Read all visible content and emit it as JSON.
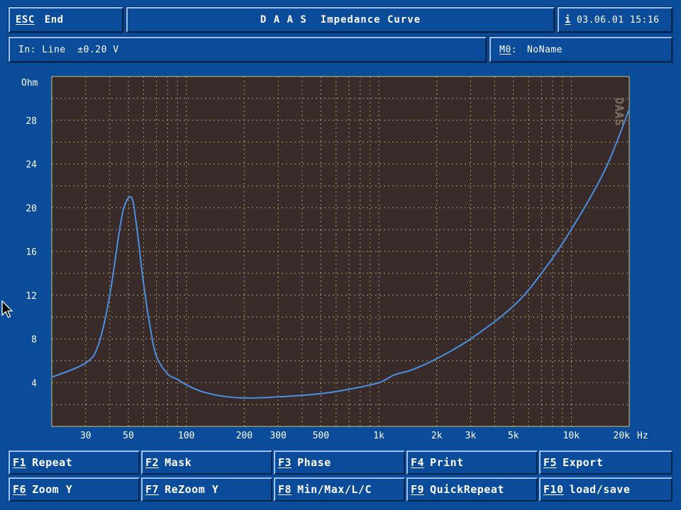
{
  "header": {
    "esc_key": "ESC",
    "esc_label": "End",
    "title": "D A A S  Impedance Curve",
    "info_key": "i",
    "datetime": "03.06.01 15:16"
  },
  "status": {
    "input": "In: Line  ±0.20 V",
    "mem_key": "M0",
    "mem_sep": ":",
    "mem_name": "NoName"
  },
  "plot": {
    "y_unit": "Ohm",
    "x_unit": "Hz",
    "watermark": "DAAS",
    "colors": {
      "background": "#3a2b2b",
      "grid": "#c8c47a",
      "curve": "#4a8fe0"
    }
  },
  "chart_data": {
    "type": "line",
    "title": "Impedance Curve",
    "xlabel": "Hz",
    "ylabel": "Ohm",
    "x_scale": "log",
    "xlim": [
      20,
      20000
    ],
    "ylim": [
      0,
      32
    ],
    "yticks": [
      4,
      8,
      12,
      16,
      20,
      24,
      28
    ],
    "xticks": [
      {
        "value": 30,
        "label": "30"
      },
      {
        "value": 50,
        "label": "50"
      },
      {
        "value": 100,
        "label": "100"
      },
      {
        "value": 200,
        "label": "200"
      },
      {
        "value": 300,
        "label": "300"
      },
      {
        "value": 500,
        "label": "500"
      },
      {
        "value": 1000,
        "label": "1k"
      },
      {
        "value": 2000,
        "label": "2k"
      },
      {
        "value": 3000,
        "label": "3k"
      },
      {
        "value": 5000,
        "label": "5k"
      },
      {
        "value": 10000,
        "label": "10k"
      },
      {
        "value": 20000,
        "label": "20k"
      }
    ],
    "series": [
      {
        "name": "",
        "x": [
          20,
          30,
          35,
          40,
          45,
          48,
          52,
          55,
          60,
          65,
          70,
          80,
          90,
          100,
          120,
          150,
          200,
          300,
          500,
          700,
          1000,
          1200,
          1500,
          2000,
          3000,
          5000,
          7000,
          10000,
          15000,
          20000
        ],
        "y": [
          4.5,
          5.8,
          7.5,
          12.0,
          18.0,
          20.3,
          20.9,
          18.5,
          13.0,
          9.0,
          6.4,
          4.8,
          4.3,
          3.8,
          3.2,
          2.8,
          2.6,
          2.7,
          3.0,
          3.4,
          4.0,
          4.7,
          5.2,
          6.2,
          8.0,
          11.0,
          14.0,
          18.0,
          23.5,
          29.0
        ]
      }
    ]
  },
  "fkeys": [
    {
      "key": "F1",
      "label": "Repeat"
    },
    {
      "key": "F2",
      "label": "Mask"
    },
    {
      "key": "F3",
      "label": "Phase"
    },
    {
      "key": "F4",
      "label": "Print"
    },
    {
      "key": "F5",
      "label": "Export"
    },
    {
      "key": "F6",
      "label": "Zoom Y"
    },
    {
      "key": "F7",
      "label": "ReZoom Y"
    },
    {
      "key": "F8",
      "label": "Min/Max/L/C"
    },
    {
      "key": "F9",
      "label": "QuickRepeat"
    },
    {
      "key": "F10",
      "label": "load/save"
    }
  ]
}
